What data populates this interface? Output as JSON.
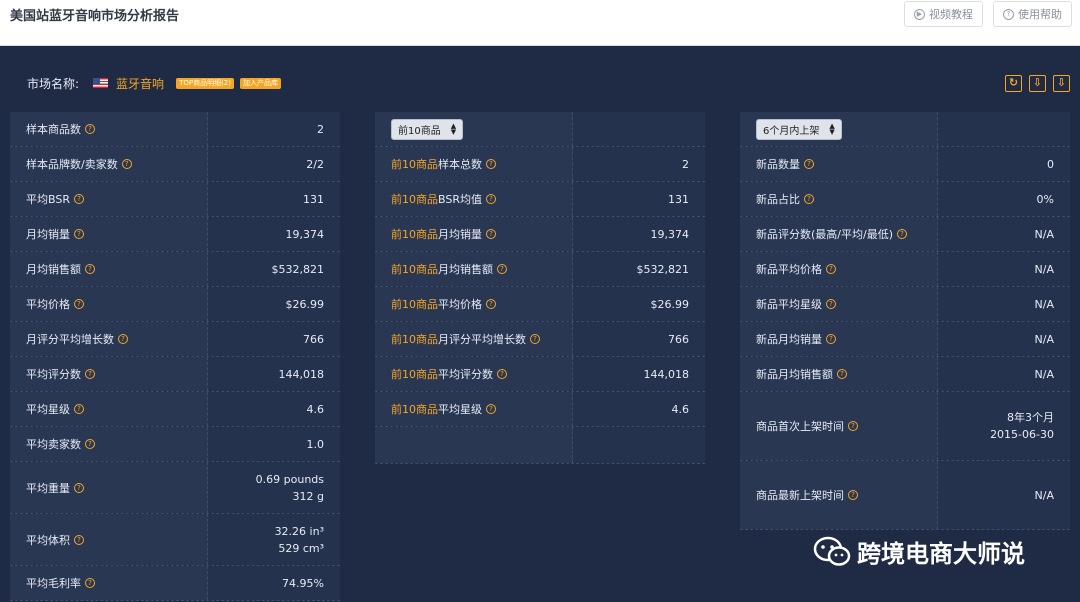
{
  "header": {
    "title": "美国站蓝牙音响市场分析报告",
    "video_btn": "视频教程",
    "help_btn": "使用帮助"
  },
  "market": {
    "label": "市场名称:",
    "name": "蓝牙音响",
    "tag1": "TOP商品明细(2)",
    "tag2": "加入产品库"
  },
  "tools": {
    "refresh": "↻",
    "download1": "⇩",
    "download2": "⇩"
  },
  "left": [
    {
      "label": "样本商品数",
      "value": "2"
    },
    {
      "label": "样本品牌数/卖家数",
      "value": "2/2"
    },
    {
      "label": "平均BSR",
      "value": "131"
    },
    {
      "label": "月均销量",
      "value": "19,374"
    },
    {
      "label": "月均销售额",
      "value": "$532,821"
    },
    {
      "label": "平均价格",
      "value": "$26.99"
    },
    {
      "label": "月评分平均增长数",
      "value": "766"
    },
    {
      "label": "平均评分数",
      "value": "144,018"
    },
    {
      "label": "平均星级",
      "value": "4.6"
    },
    {
      "label": "平均卖家数",
      "value": "1.0"
    },
    {
      "label": "平均重量",
      "value": "0.69 pounds",
      "value2": "312 g"
    },
    {
      "label": "平均体积",
      "value": "32.26 in³",
      "value2": "529 cm³"
    },
    {
      "label": "平均毛利率",
      "value": "74.95%"
    }
  ],
  "middle": {
    "select": "前10商品",
    "prefix": "前10商品",
    "rows": [
      {
        "label": "样本总数",
        "value": "2"
      },
      {
        "label": "BSR均值",
        "value": "131"
      },
      {
        "label": "月均销量",
        "value": "19,374"
      },
      {
        "label": "月均销售额",
        "value": "$532,821"
      },
      {
        "label": "平均价格",
        "value": "$26.99"
      },
      {
        "label": "月评分平均增长数",
        "value": "766"
      },
      {
        "label": "平均评分数",
        "value": "144,018"
      },
      {
        "label": "平均星级",
        "value": "4.6"
      }
    ]
  },
  "right": {
    "select": "6个月内上架",
    "rows": [
      {
        "label": "新品数量",
        "value": "0"
      },
      {
        "label": "新品占比",
        "value": "0%"
      },
      {
        "label": "新品评分数(最高/平均/最低)",
        "value": "N/A"
      },
      {
        "label": "新品平均价格",
        "value": "N/A"
      },
      {
        "label": "新品平均星级",
        "value": "N/A"
      },
      {
        "label": "新品月均销量",
        "value": "N/A"
      },
      {
        "label": "新品月均销售额",
        "value": "N/A"
      },
      {
        "label": "商品首次上架时间",
        "value": "8年3个月",
        "value2": "2015-06-30"
      },
      {
        "label": "商品最新上架时间",
        "value": "N/A"
      }
    ]
  },
  "watermark": "跨境电商大师说"
}
